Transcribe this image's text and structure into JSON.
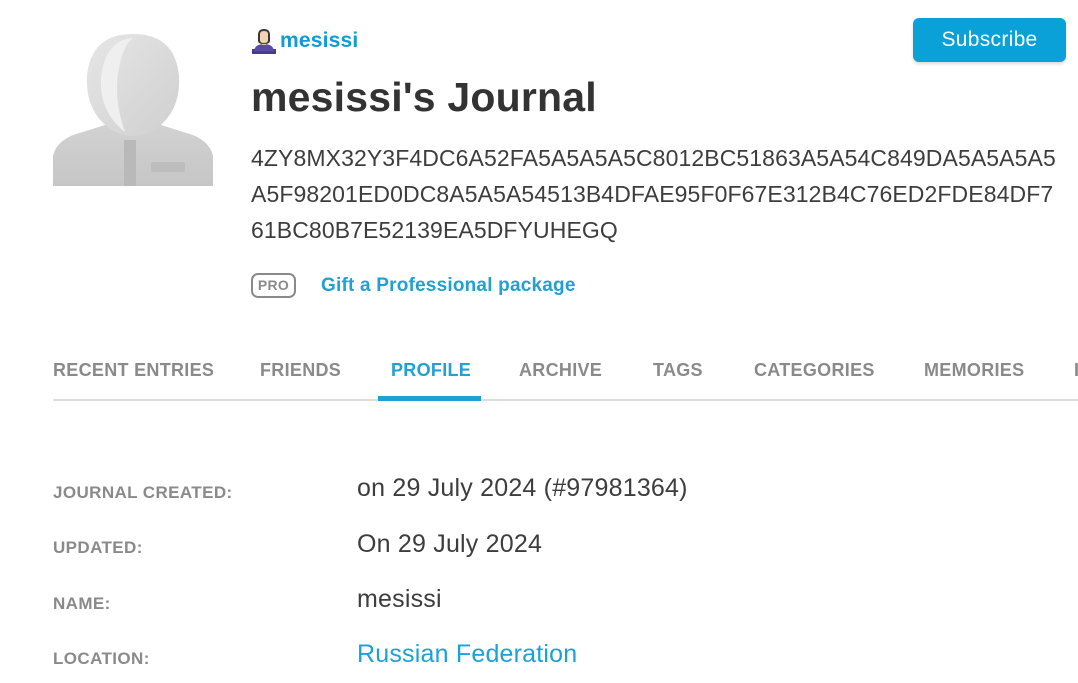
{
  "header": {
    "username": "mesissi",
    "subscribe_label": "Subscribe",
    "title": "mesissi's Journal",
    "description": "4ZY8MX32Y3F4DC6A52FA5A5A5A5C8012BC51863A5A54C849DA5A5A5A5A5F98201ED0DC8A5A5A54513B4DFAE95F0F67E312B4C76ED2FDE84DF761BC80B7E52139EA5DFYUHEGQ",
    "pro_badge": "PRO",
    "gift_label": "Gift a Professional package"
  },
  "icons": {
    "avatar": "default-user-silhouette",
    "user_icon": "user-icon"
  },
  "tabs": [
    {
      "label": "RECENT ENTRIES",
      "active": false
    },
    {
      "label": "FRIENDS",
      "active": false
    },
    {
      "label": "PROFILE",
      "active": true
    },
    {
      "label": "ARCHIVE",
      "active": false
    },
    {
      "label": "TAGS",
      "active": false
    },
    {
      "label": "CATEGORIES",
      "active": false
    },
    {
      "label": "MEMORIES",
      "active": false
    },
    {
      "label": "I",
      "active": false
    }
  ],
  "profile": {
    "journal_created": {
      "label": "JOURNAL CREATED:",
      "value": "on 29 July 2024 (#97981364)"
    },
    "updated": {
      "label": "UPDATED:",
      "value": "On 29 July 2024"
    },
    "name": {
      "label": "NAME:",
      "value": "mesissi"
    },
    "location": {
      "label": "LOCATION:",
      "value": "Russian Federation"
    }
  },
  "colors": {
    "accent": "#21a0d2",
    "subscribe_bg": "#0aa0d8",
    "muted": "#8a8a8a",
    "text": "#333333"
  }
}
